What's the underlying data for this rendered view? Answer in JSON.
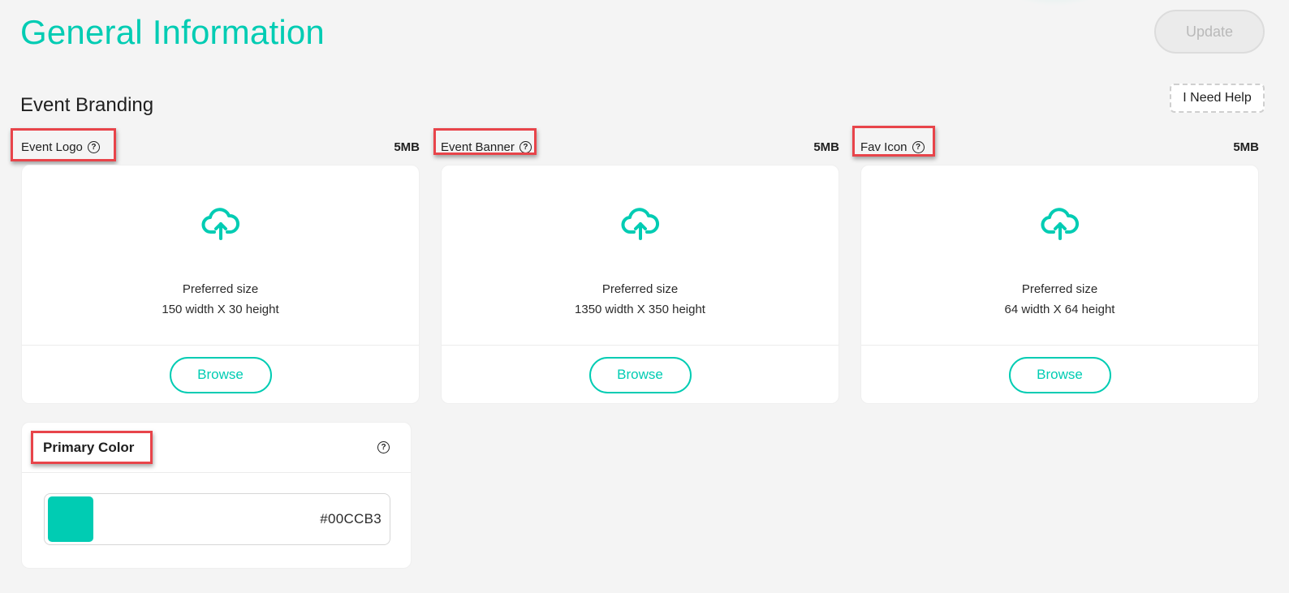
{
  "header": {
    "title": "General Information",
    "update_label": "Update"
  },
  "branding": {
    "section_title": "Event Branding",
    "help_label": "I Need Help",
    "uploads": [
      {
        "label": "Event Logo",
        "size_limit": "5MB",
        "pref_line1": "Preferred size",
        "pref_line2": "150 width X 30 height",
        "browse_label": "Browse"
      },
      {
        "label": "Event Banner",
        "size_limit": "5MB",
        "pref_line1": "Preferred size",
        "pref_line2": "1350 width X 350 height",
        "browse_label": "Browse"
      },
      {
        "label": "Fav Icon",
        "size_limit": "5MB",
        "pref_line1": "Preferred size",
        "pref_line2": "64 width X 64 height",
        "browse_label": "Browse"
      }
    ]
  },
  "primary_color": {
    "title": "Primary Color",
    "value": "#00CCB3",
    "swatch_color": "#00ccb3"
  },
  "icons": {
    "help": "question-circle-icon",
    "upload": "cloud-upload-icon",
    "help_glyph": "?"
  },
  "colors": {
    "accent": "#00ccb3",
    "annotation": "#e8444a",
    "background": "#f4f4f4"
  }
}
